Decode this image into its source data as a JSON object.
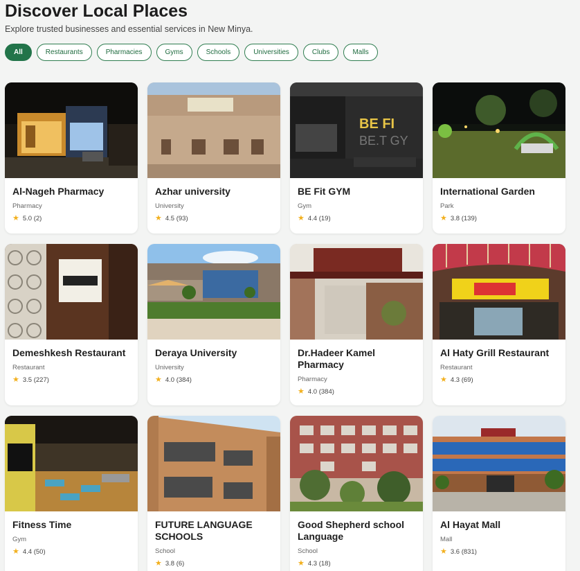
{
  "header": {
    "title": "Discover Local Places",
    "subtitle": "Explore trusted businesses and essential services in New Minya."
  },
  "filters": [
    {
      "label": "All",
      "active": true
    },
    {
      "label": "Restaurants"
    },
    {
      "label": "Pharmacies"
    },
    {
      "label": "Gyms"
    },
    {
      "label": "Schools"
    },
    {
      "label": "Universities"
    },
    {
      "label": "Clubs"
    },
    {
      "label": "Malls"
    }
  ],
  "places": [
    {
      "name": "Al-Nageh Pharmacy",
      "category": "Pharmacy",
      "rating": "5.0 (2)"
    },
    {
      "name": "Azhar university",
      "category": "University",
      "rating": "4.5 (93)"
    },
    {
      "name": "BE Fit GYM",
      "category": "Gym",
      "rating": "4.4 (19)"
    },
    {
      "name": "International Garden",
      "category": "Park",
      "rating": "3.8 (139)"
    },
    {
      "name": "Demeshkesh Restaurant",
      "category": "Restaurant",
      "rating": "3.5 (227)"
    },
    {
      "name": "Deraya University",
      "category": "University",
      "rating": "4.0 (384)"
    },
    {
      "name": "Dr.Hadeer Kamel Pharmacy",
      "category": "Pharmacy",
      "rating": "4.0 (384)"
    },
    {
      "name": "Al Haty Grill Restaurant",
      "category": "Restaurant",
      "rating": "4.3 (69)"
    },
    {
      "name": "Fitness Time",
      "category": "Gym",
      "rating": "4.4 (50)"
    },
    {
      "name": "FUTURE LANGUAGE SCHOOLS",
      "category": "School",
      "rating": "3.8 (6)"
    },
    {
      "name": "Good Shepherd school Language",
      "category": "School",
      "rating": "4.3 (18)"
    },
    {
      "name": "Al Hayat Mall",
      "category": "Mall",
      "rating": "3.6 (831)"
    }
  ],
  "icons": {
    "rating": "star-icon"
  },
  "colors": {
    "accent": "#22744a",
    "star": "#f2b01e"
  }
}
